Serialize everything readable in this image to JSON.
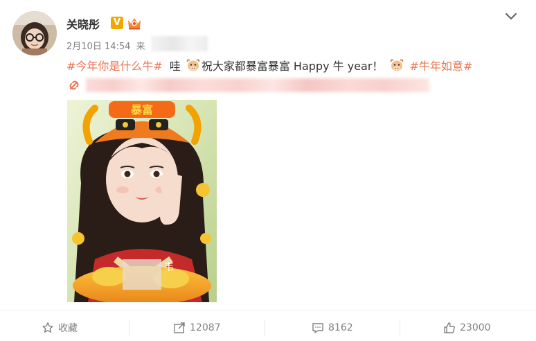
{
  "user": {
    "name": "关晓彤",
    "verified_badge": "V"
  },
  "post": {
    "time": "2月10日 14:54",
    "source_prefix": "来",
    "hashtag1": "#今年你是什么牛#",
    "text_wa": "哇",
    "text_main": "祝大家都暴富暴富 Happy 牛 year！",
    "hashtag2": "#牛年如意#"
  },
  "photo": {
    "hat_text": "暴富",
    "icon": "photo-image"
  },
  "actions": {
    "favorite_label": "收藏",
    "repost_count": "12087",
    "comment_count": "8162",
    "like_count": "23000"
  },
  "colors": {
    "hashtag": "#eb7350",
    "verified": "#f2a700",
    "meta_gray": "#808080"
  }
}
